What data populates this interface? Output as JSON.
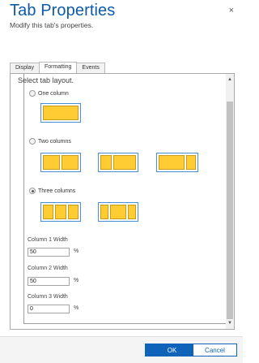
{
  "dialog": {
    "title": "Tab Properties",
    "subtitle": "Modify this tab's properties.",
    "close_icon": "×"
  },
  "tabs": [
    {
      "label": "Display",
      "active": false
    },
    {
      "label": "Formatting",
      "active": true
    },
    {
      "label": "Events",
      "active": false
    }
  ],
  "layout_section": {
    "heading": "Select tab layout.",
    "options": [
      {
        "label": "One column",
        "checked": false
      },
      {
        "label": "Two columns",
        "checked": false
      },
      {
        "label": "Three columns",
        "checked": true
      }
    ]
  },
  "column_widths": [
    {
      "label": "Column 1 Width",
      "value": "50",
      "unit": "%"
    },
    {
      "label": "Column 2 Width",
      "value": "50",
      "unit": "%"
    },
    {
      "label": "Column 3 Width",
      "value": "0",
      "unit": "%"
    }
  ],
  "footer": {
    "ok_label": "OK",
    "cancel_label": "Cancel"
  },
  "colors": {
    "accent": "#0f63b8",
    "title": "#0f5aa6",
    "layout_cell": "#ffcc33",
    "layout_border": "#4a8fd6"
  }
}
